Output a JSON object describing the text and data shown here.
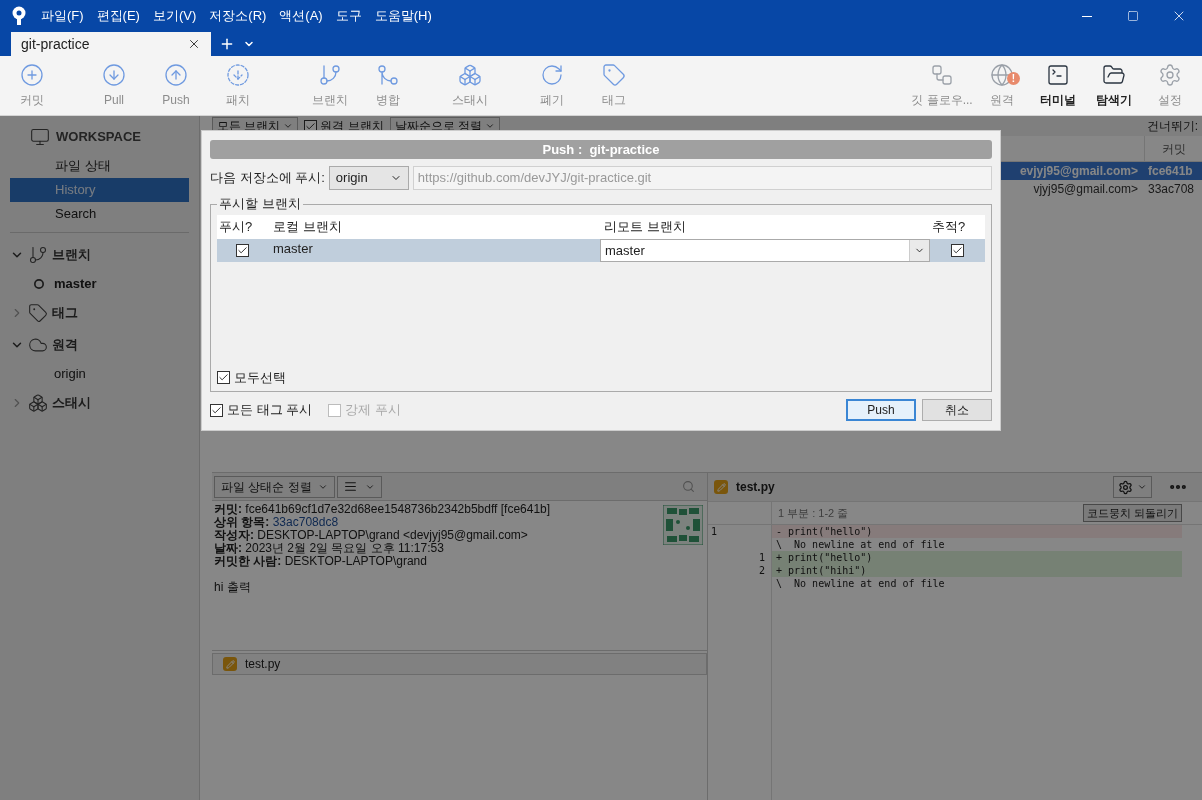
{
  "window": {
    "menu": [
      "파일(F)",
      "편집(E)",
      "보기(V)",
      "저장소(R)",
      "액션(A)",
      "도구",
      "도움말(H)"
    ]
  },
  "tabs": [
    {
      "label": "git-practice",
      "selected": true
    }
  ],
  "toolbar": [
    {
      "label": "커밋",
      "kind": "commit",
      "disabled": true
    },
    {
      "label": "Pull",
      "kind": "pull",
      "disabled": true
    },
    {
      "label": "Push",
      "kind": "push",
      "disabled": true
    },
    {
      "label": "패치",
      "kind": "fetch",
      "disabled": true
    },
    {
      "label": "브랜치",
      "kind": "branch",
      "disabled": true
    },
    {
      "label": "병합",
      "kind": "merge",
      "disabled": true
    },
    {
      "label": "스태시",
      "kind": "stash",
      "disabled": true
    },
    {
      "label": "폐기",
      "kind": "discard",
      "disabled": true
    },
    {
      "label": "태그",
      "kind": "tag",
      "disabled": true
    },
    {
      "label": "깃 플로우...",
      "kind": "flow",
      "disabled": true
    },
    {
      "label": "원격",
      "kind": "remote",
      "disabled": true,
      "badge": "!"
    },
    {
      "label": "터미널",
      "kind": "terminal",
      "disabled": false
    },
    {
      "label": "탐색기",
      "kind": "explorer",
      "disabled": false
    },
    {
      "label": "설정",
      "kind": "settings",
      "disabled": true
    }
  ],
  "sidebar": {
    "workspace": "WORKSPACE",
    "items": [
      {
        "label": "파일 상태",
        "selected": false
      },
      {
        "label": "History",
        "selected": true
      },
      {
        "label": "Search",
        "selected": false
      }
    ],
    "sections": [
      {
        "label": "브랜치",
        "kind": "branch",
        "expanded": true,
        "children": [
          {
            "label": "master",
            "current": true
          }
        ]
      },
      {
        "label": "태그",
        "kind": "tag",
        "expanded": false
      },
      {
        "label": "원격",
        "kind": "cloud",
        "expanded": true,
        "children": [
          {
            "label": "origin",
            "current": false
          }
        ]
      },
      {
        "label": "스태시",
        "kind": "stash",
        "expanded": false
      }
    ]
  },
  "history": {
    "branches": "모든 브랜치",
    "remote_filter": {
      "label": "원격 브랜치",
      "checked": true
    },
    "sort": "날짜순으로 정렬",
    "jump": "건너뛰기:",
    "column": "커밋",
    "rows": [
      {
        "author": "evjyj95@gmail.com>",
        "commit": "fce641b",
        "selected": true
      },
      {
        "author": "vjyj95@gmail.com>",
        "commit": "33ac708",
        "selected": false
      }
    ]
  },
  "details": {
    "sort": "파일 상태순 정렬",
    "fields": [
      {
        "label": "커밋:",
        "value": "fce641b69cf1d7e32d68ee1548736b2342b5bdff [fce641b]",
        "kind": "text"
      },
      {
        "label": "상위 항목:",
        "value": "33ac708dc8",
        "kind": "link"
      },
      {
        "label": "작성자:",
        "value": "DESKTOP-LAPTOP\\grand <devjyj95@gmail.com>",
        "kind": "text"
      },
      {
        "label": "날짜:",
        "value": "2023년 2월 2일 목요일 오후 11:17:53",
        "kind": "text"
      },
      {
        "label": "커밋한 사람:",
        "value": "DESKTOP-LAPTOP\\grand",
        "kind": "text"
      }
    ],
    "message": "hi 출력",
    "files": [
      {
        "name": "test.py"
      }
    ]
  },
  "diff": {
    "file": "test.py",
    "hunk": "1 부분 : 1-2 줄",
    "revert": "코드뭉치 되돌리기",
    "lines": [
      {
        "kind": "removed",
        "old": "1",
        "text": "- print(\"hello\")"
      },
      {
        "kind": "context",
        "text": "\\  No newline at end of file"
      },
      {
        "kind": "added",
        "new": "1",
        "text": "+ print(\"hello\")"
      },
      {
        "kind": "added",
        "new": "2",
        "text": "+ print(\"hihi\")"
      },
      {
        "kind": "context",
        "text": "\\  No newline at end of file"
      }
    ]
  },
  "dialog": {
    "title": "Push :  git-practice",
    "repo_label": "다음 저장소에 푸시:",
    "remote": "origin",
    "url": "https://github.com/devJYJ/git-practice.git",
    "group": "푸시할 브랜치",
    "columns": [
      "푸시?",
      "로컬 브랜치",
      "리모트 브랜치",
      "추적?"
    ],
    "rows": [
      {
        "push": true,
        "local": "master",
        "remote": "master",
        "track": true,
        "selected": true
      }
    ],
    "select_all": {
      "label": "모두선택",
      "checked": true
    },
    "options": [
      {
        "label": "모든 태그 푸시",
        "checked": true,
        "disabled": false
      },
      {
        "label": "강제 푸시",
        "checked": false,
        "disabled": true
      }
    ],
    "buttons": [
      {
        "label": "Push",
        "default": true
      },
      {
        "label": "취소",
        "default": false
      }
    ]
  }
}
